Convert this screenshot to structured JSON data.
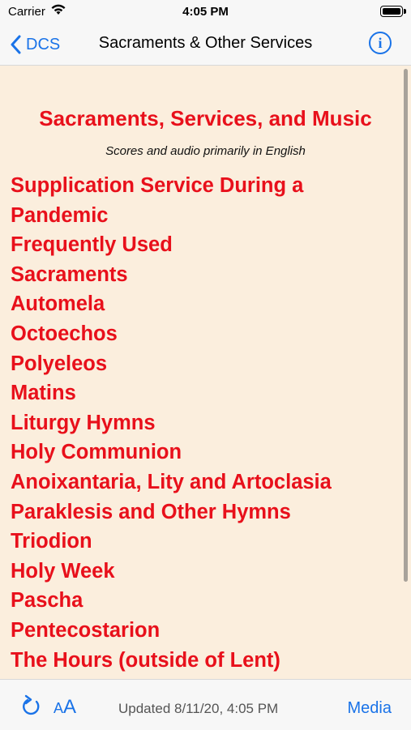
{
  "status": {
    "carrier": "Carrier",
    "time": "4:05 PM",
    "wifi_icon": "wifi-icon",
    "battery_icon": "battery-icon"
  },
  "nav": {
    "back_label": "DCS",
    "title": "Sacraments & Other Services",
    "info_glyph": "i"
  },
  "content": {
    "heading": "Sacraments, Services, and Music",
    "subheading": "Scores and audio primarily in English",
    "items": [
      "Supplication Service During a Pandemic",
      "Frequently Used",
      "Sacraments",
      "Automela",
      "Octoechos",
      "Polyeleos",
      "Matins",
      "Liturgy Hymns",
      "Holy Communion",
      "Anoixantaria, Lity and Artoclasia",
      "Paraklesis and Other Hymns",
      "Triodion",
      "Holy Week",
      "Pascha",
      "Pentecostarion",
      "The Hours (outside of Lent)"
    ]
  },
  "toolbar": {
    "font_small": "A",
    "font_big": "A",
    "updated_text": "Updated 8/11/20, 4:05 PM",
    "media_label": "Media"
  },
  "colors": {
    "accent": "#1a73e8",
    "heading_red": "#e8101b",
    "background": "#fbeedd"
  }
}
